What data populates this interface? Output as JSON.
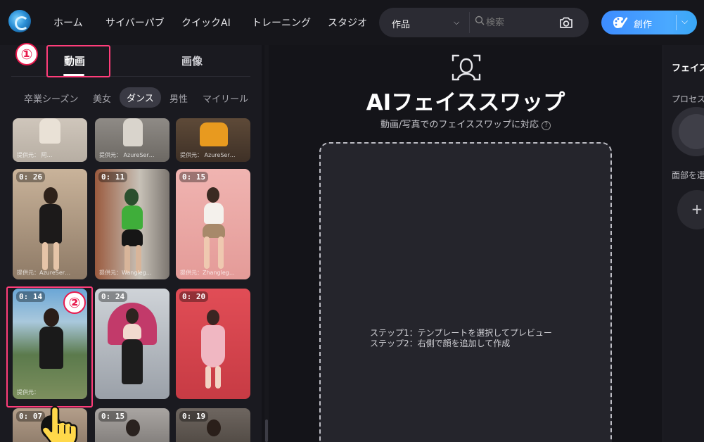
{
  "nav": {
    "items": [
      "ホーム",
      "サイバーパブ",
      "クイックAI",
      "トレーニング",
      "スタジオ"
    ]
  },
  "search": {
    "category_value": "作品",
    "placeholder": "検索"
  },
  "create_button": {
    "label": "創作"
  },
  "left_panel": {
    "tabs": [
      {
        "label": "動画",
        "active": true
      },
      {
        "label": "画像",
        "active": false
      }
    ],
    "categories": [
      {
        "label": "卒業シーズン",
        "active": false
      },
      {
        "label": "美女",
        "active": false
      },
      {
        "label": "ダンス",
        "active": true
      },
      {
        "label": "男性",
        "active": false
      },
      {
        "label": "マイリール",
        "active": false
      }
    ],
    "annotations": [
      "①",
      "②"
    ],
    "cards": [
      {
        "duration": "",
        "credit": "提供元： 阿…"
      },
      {
        "duration": "",
        "credit": "提供元： AzureSer…"
      },
      {
        "duration": "",
        "credit": "提供元： AzureSer…"
      },
      {
        "duration": "0: 26",
        "credit": "提供元：AzureSer…"
      },
      {
        "duration": "0: 11",
        "credit": "提供元：Wangleg…"
      },
      {
        "duration": "0: 15",
        "credit": "提供元：Zhangleg…"
      },
      {
        "duration": "0: 14",
        "credit": "提供元："
      },
      {
        "duration": "0: 24",
        "credit": ""
      },
      {
        "duration": "0: 20",
        "credit": ""
      },
      {
        "duration": "0: 07",
        "credit": ""
      },
      {
        "duration": "0: 15",
        "credit": ""
      },
      {
        "duration": "0: 19",
        "credit": ""
      }
    ]
  },
  "center": {
    "title": "AIフェイススワップ",
    "subtitle": "動画/写真でのフェイススワップに対応",
    "step1": "ステップ1：テンプレートを選択してプレビュー",
    "step2": "ステップ2：右側で顔を追加して作成"
  },
  "right_panel": {
    "title": "フェイス",
    "process_label": "プロセス",
    "face_label": "面部を選",
    "add_symbol": "+"
  },
  "colors": {
    "accent": "#4a9dff",
    "annotation": "#ff3d7a"
  }
}
